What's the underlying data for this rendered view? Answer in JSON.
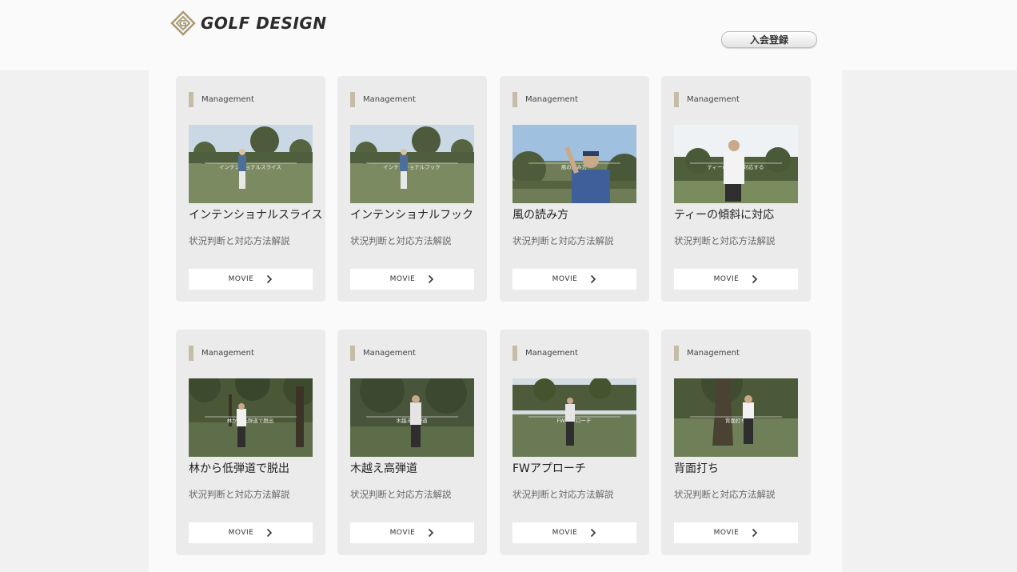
{
  "header": {
    "logo_text": "GOLF DESIGN",
    "register_label": "入会登録"
  },
  "colors": {
    "page_bg": "#f1f1f1",
    "content_bg": "#fafafa",
    "card_bg": "#ebebeb",
    "category_bar": "#c4bca6",
    "logo_gold": "#a89a72"
  },
  "cards": [
    {
      "category": "Management",
      "title": "インテンショナルスライス",
      "desc": "状況判断と対応方法解説",
      "button": "MOVIE",
      "thumb_caption": "インテンショナルスライス",
      "scene": "fairway-swing"
    },
    {
      "category": "Management",
      "title": "インテンショナルフック",
      "desc": "状況判断と対応方法解説",
      "button": "MOVIE",
      "thumb_caption": "インテンショナルフック",
      "scene": "fairway-swing"
    },
    {
      "category": "Management",
      "title": "風の読み方",
      "desc": "状況判断と対応方法解説",
      "button": "MOVIE",
      "thumb_caption": "風の読み方",
      "scene": "pointing-sky"
    },
    {
      "category": "Management",
      "title": "ティーの傾斜に対応",
      "desc": "状況判断と対応方法解説",
      "button": "MOVIE",
      "thumb_caption": "ティーの傾斜に対応する",
      "scene": "standing-tee"
    },
    {
      "category": "Management",
      "title": "林から低弾道で脱出",
      "desc": "状況判断と対応方法解説",
      "button": "MOVIE",
      "thumb_caption": "林から低弾道で脱出",
      "scene": "trees-address"
    },
    {
      "category": "Management",
      "title": "木越え高弾道",
      "desc": "状況判断と対応方法解説",
      "button": "MOVIE",
      "thumb_caption": "木越え高弾道",
      "scene": "trees-finish"
    },
    {
      "category": "Management",
      "title": "FWアプローチ",
      "desc": "状況判断と対応方法解説",
      "button": "MOVIE",
      "thumb_caption": "FWアプローチ",
      "scene": "fairway-address"
    },
    {
      "category": "Management",
      "title": "背面打ち",
      "desc": "状況判断と対応方法解説",
      "button": "MOVIE",
      "thumb_caption": "背面打ち",
      "scene": "big-tree"
    }
  ]
}
